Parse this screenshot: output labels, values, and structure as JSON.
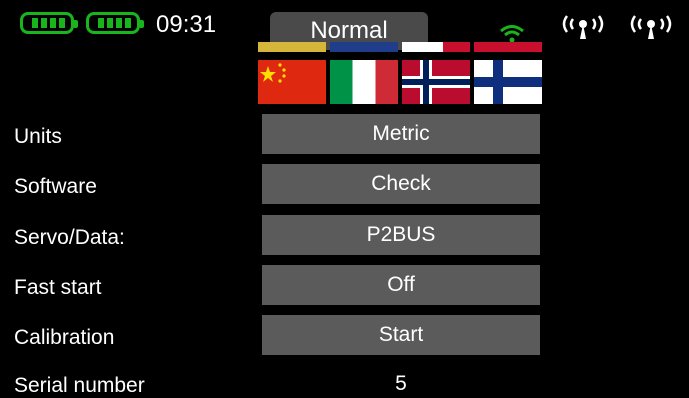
{
  "status": {
    "time": "09:31",
    "mode": "Normal",
    "icons": [
      "battery-icon",
      "battery-icon",
      "wifi-icon",
      "antenna-icon",
      "antenna-icon"
    ]
  },
  "colors": {
    "background": "#000000",
    "button": "#5b5b5b",
    "mode_tab": "#4a4a4a",
    "battery": "#19b51c",
    "wifi": "#19b51c"
  },
  "flags": [
    "china-flag",
    "italy-flag",
    "norway-flag",
    "finland-flag"
  ],
  "settings": [
    {
      "label": "Units",
      "value": "Metric"
    },
    {
      "label": "Software",
      "value": "Check"
    },
    {
      "label": "Servo/Data:",
      "value": "P2BUS"
    },
    {
      "label": "Fast start",
      "value": "Off"
    },
    {
      "label": "Calibration",
      "value": "Start"
    }
  ],
  "serial": {
    "label": "Serial number",
    "value": "5"
  }
}
